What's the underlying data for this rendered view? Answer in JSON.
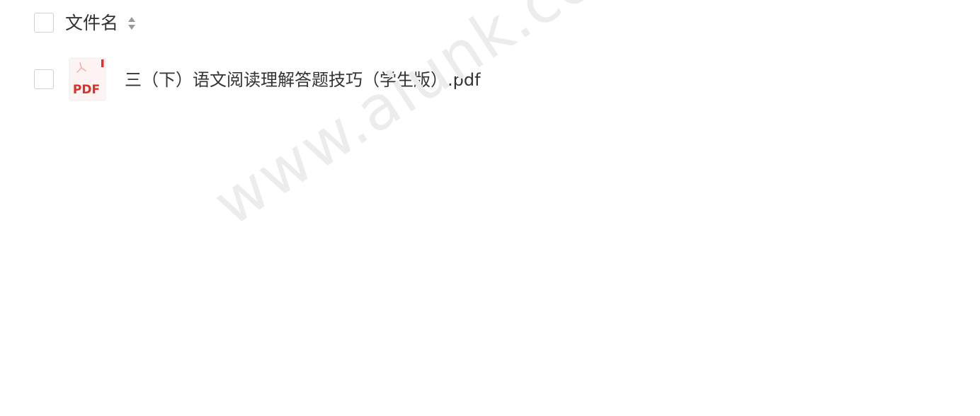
{
  "header": {
    "column_label": "文件名",
    "sort_icon": "sort-icon"
  },
  "files": [
    {
      "name": "三（下）语文阅读理解答题技巧（学生版）.pdf",
      "icon": "pdf-file-icon",
      "icon_label": "PDF"
    }
  ],
  "watermark": {
    "text": "www.aiunk.com"
  },
  "colors": {
    "pdf_red": "#d9312b",
    "text": "#333333",
    "border": "#cfcfcf",
    "watermark": "#ececec"
  }
}
